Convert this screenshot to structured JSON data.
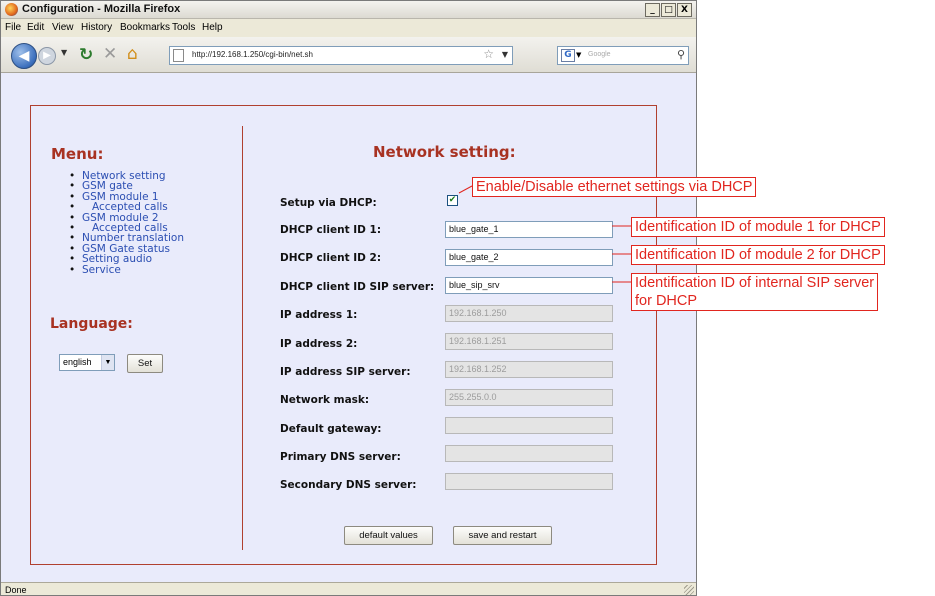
{
  "window": {
    "title": "Configuration - Mozilla Firefox",
    "min": "_",
    "max": "□",
    "close": "X"
  },
  "menubar": [
    "File",
    "Edit",
    "View",
    "History",
    "Bookmarks",
    "Tools",
    "Help"
  ],
  "toolbar": {
    "url": "http://192.168.1.250/cgi-bin/net.sh",
    "search_placeholder": "Google"
  },
  "sidebar": {
    "title": "Menu:",
    "items": [
      {
        "label": "Network setting",
        "indent": false
      },
      {
        "label": "GSM gate",
        "indent": false
      },
      {
        "label": "GSM module 1",
        "indent": false
      },
      {
        "label": "Accepted calls",
        "indent": true
      },
      {
        "label": "GSM module 2",
        "indent": false
      },
      {
        "label": "Accepted calls",
        "indent": true
      },
      {
        "label": "Number translation",
        "indent": false
      },
      {
        "label": "GSM Gate status",
        "indent": false
      },
      {
        "label": "Setting audio",
        "indent": false
      },
      {
        "label": "Service",
        "indent": false
      }
    ],
    "language_title": "Language:",
    "language_value": "english",
    "set_button": "Set"
  },
  "main": {
    "title": "Network setting:",
    "dhcp": {
      "label": "Setup via DHCP:",
      "checked": true
    },
    "fields": [
      {
        "label": "DHCP client ID 1:",
        "value": "blue_gate_1",
        "disabled": false
      },
      {
        "label": "DHCP client ID 2:",
        "value": "blue_gate_2",
        "disabled": false
      },
      {
        "label": "DHCP client ID SIP server:",
        "value": "blue_sip_srv",
        "disabled": false
      },
      {
        "label": "IP address 1:",
        "value": "192.168.1.250",
        "disabled": true
      },
      {
        "label": "IP address 2:",
        "value": "192.168.1.251",
        "disabled": true
      },
      {
        "label": "IP address SIP server:",
        "value": "192.168.1.252",
        "disabled": true
      },
      {
        "label": "Network mask:",
        "value": "255.255.0.0",
        "disabled": true
      },
      {
        "label": "Default gateway:",
        "value": "",
        "disabled": true
      },
      {
        "label": "Primary DNS server:",
        "value": "",
        "disabled": true
      },
      {
        "label": "Secondary DNS server:",
        "value": "",
        "disabled": true
      }
    ],
    "default_button": "default values",
    "save_button": "save and restart"
  },
  "status": "Done",
  "annotations": {
    "dhcp": "Enable/Disable ethernet settings via DHCP",
    "id1": "Identification ID of module 1 for DHCP",
    "id2": "Identification ID of module 2 for DHCP",
    "sip_line1": "Identification ID of internal SIP server",
    "sip_line2": "for DHCP"
  },
  "colors": {
    "heading": "#a83222",
    "link": "#2b4eb2",
    "annotation": "#e1261f",
    "page_bg": "#e9ebfb"
  },
  "icons": [
    "firefox-icon",
    "back-arrow-icon",
    "forward-arrow-icon",
    "reload-icon",
    "stop-icon",
    "home-icon",
    "page-icon",
    "bookmark-star-icon",
    "google-icon",
    "search-icon",
    "checkmark-icon"
  ]
}
